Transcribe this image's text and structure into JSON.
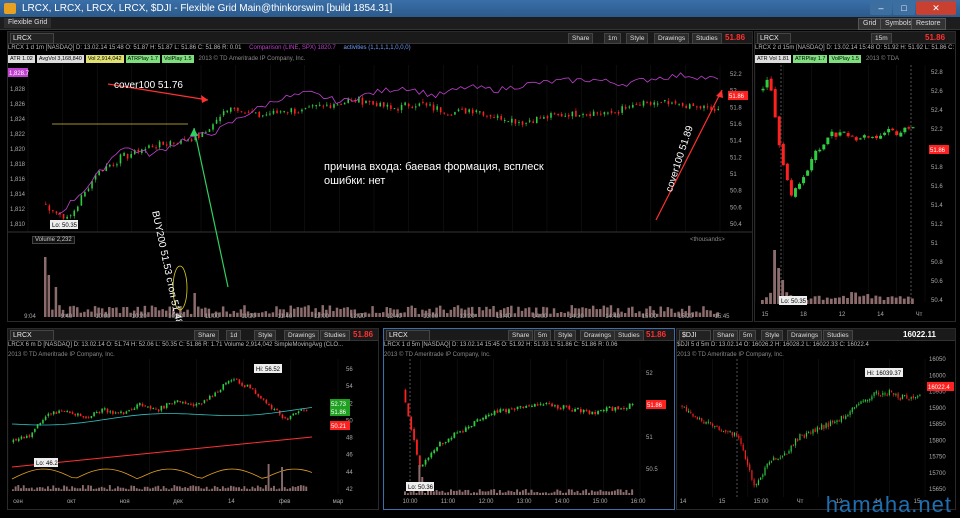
{
  "window": {
    "title": "LRCX, LRCX, LRCX, LRCX, $DJI - Flexible Grid Main@thinkorswim [build 1854.31]",
    "icon": "tos-logo-icon"
  },
  "menubar": {
    "tab": "Flexible Grid",
    "grid": "Grid",
    "symbols": "Symbols",
    "restore": "Restore"
  },
  "common": {
    "share": "Share",
    "style": "Style",
    "drawings": "Drawings",
    "studies": "Studies"
  },
  "main": {
    "symbol": "LRCX",
    "interval": "1m",
    "price": "51.86",
    "info": "LRCX 1 d 1m [NASDAQ] D: 13.02.14 15:48 O: 51.87 H: 51.87 L: 51.86 C: 51.86 R: 0.01",
    "comparison": "Comparison (LINE, SPX) 1820.7",
    "activities": "activities (1,1,1,1,1,0,0,0)",
    "studies": [
      "ATR 1.02",
      "AvgVol 3,168,840",
      "Vol 2,914,042",
      "ATRPlay 1.7",
      "VolPlay 1.5"
    ],
    "copyright": "2013 © TD Ameritrade IP Company, Inc.",
    "volume_label": "Volume",
    "volume_value": "2,232",
    "thousands": "<thousands>",
    "lo": "Lo: 50.35",
    "y_left": [
      "1,830",
      "1,828",
      "1,826",
      "1,824",
      "1,822",
      "1,820",
      "1,818",
      "1,816",
      "1,814",
      "1,812",
      "1,810"
    ],
    "y_right": [
      "52.2",
      "52",
      "51.8",
      "51.6",
      "51.4",
      "51.2",
      "51",
      "50.8",
      "50.6",
      "50.4"
    ],
    "price_tag_right": "51.86",
    "price_tag_left": "1,828.7",
    "x_ticks": [
      "9:04",
      "9:40",
      "10:00",
      "10:20",
      "10:40",
      "11:00",
      "11:20",
      "11:40",
      "12:00",
      "12:20",
      "12:40",
      "13:00",
      "13:20",
      "13:40",
      "14:00",
      "14:20",
      "14:40",
      "15:00",
      "15:20",
      "15:45"
    ],
    "annot_cover1": "cover100 51.76",
    "annot_buy": "BUY200 51.53 стоп 51.48",
    "annot_cover2": "cover100 51.89",
    "annot_reason": "причина входа: баевая формация, всплеск ошибки: нет"
  },
  "right": {
    "symbol": "LRCX",
    "interval": "15m",
    "price": "51.86",
    "info": "LRCX 2 d 15m [NASDAQ] D: 13.02.14 15:48 O: 51.92 H: 51.92 L: 51.86 C: 51.86 R: 0.01",
    "studies": [
      "ATR Vol 1.81",
      "ATRPlay 1.7",
      "VolPlay 1.5"
    ],
    "copyright": "2013 © TDA",
    "lo": "Lo: 50.35",
    "y": [
      "52.8",
      "52.6",
      "52.4",
      "52.2",
      "52",
      "51.8",
      "51.6",
      "51.4",
      "51.2",
      "51",
      "50.8",
      "50.6",
      "50.4"
    ],
    "price_tag": "51.86",
    "x_ticks": [
      "15",
      "18",
      "12",
      "14",
      "Чт"
    ]
  },
  "bl": {
    "symbol": "LRCX",
    "interval": "1d",
    "price": "51.86",
    "info": "LRCX 6 m D [NASDAQ] D: 13.02.14 O: 51.74 H: 52.06 L: 50.35 C: 51.86 R: 1.71 Volume 2,914,042 SimpleMovingAvg (CLO...",
    "copyright": "2013 © TD Ameritrade IP Company, Inc.",
    "hi": "Hi: 56.52",
    "lo": "Lo: 46.2",
    "y": [
      "56",
      "54",
      "52",
      "50",
      "48",
      "46",
      "44",
      "42"
    ],
    "tags": [
      "52.73",
      "51.86",
      "50.21"
    ],
    "x_ticks": [
      "сен",
      "окт",
      "ноя",
      "дек",
      "14",
      "фев",
      "мар"
    ]
  },
  "bm": {
    "symbol": "LRCX",
    "interval": "5m",
    "price": "51.86",
    "info": "LRCX 1 d 5m [NASDAQ] D: 13.02.14 15:45 O: 51.92 H: 51.93 L: 51.86 C: 51.86 R: 0.06",
    "copyright": "2013 © TD Ameritrade IP Company, Inc.",
    "lo": "Lo: 50.36",
    "y": [
      "52",
      "51.5",
      "51",
      "50.5"
    ],
    "price_tag": "51.86",
    "x_ticks": [
      "10:00",
      "11:00",
      "12:00",
      "13:00",
      "14:00",
      "15:00",
      "16:00"
    ]
  },
  "br": {
    "symbol": "$DJI",
    "interval": "5m",
    "price": "16022.11",
    "info": "$DJI 5 d 5m D: 13.02.14 O: 16026.2 H: 16028.2 L: 16022.33 C: 16022.4",
    "copyright": "2013 © TD Ameritrade IP Company, Inc.",
    "hi": "Hi: 16039.37",
    "y": [
      "16050",
      "16000",
      "15950",
      "15900",
      "15850",
      "15800",
      "15750",
      "15700",
      "15650"
    ],
    "price_tag": "16022.4",
    "x_ticks": [
      "14",
      "15",
      "15:00",
      "Чт",
      "12",
      "14",
      "15"
    ]
  },
  "watermark": "hamaha.net",
  "colors": {
    "up": "#2ecc40",
    "down": "#ff2020",
    "compare": "#c040d0",
    "volume": "#8b6b6b",
    "accent": "#3a6fa8"
  }
}
